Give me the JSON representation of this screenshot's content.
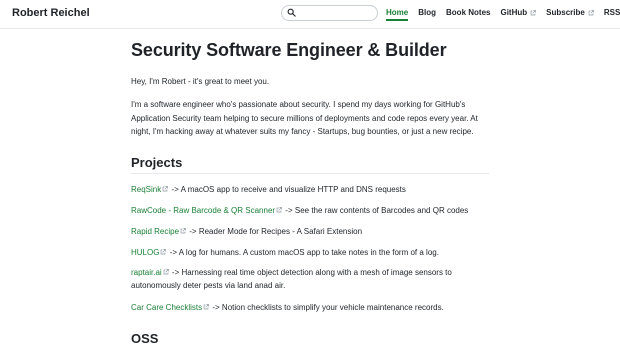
{
  "header": {
    "site_title": "Robert Reichel",
    "search": {
      "placeholder": "",
      "value": ""
    },
    "nav": [
      {
        "label": "Home",
        "external": false,
        "active": true
      },
      {
        "label": "Blog",
        "external": false,
        "active": false
      },
      {
        "label": "Book Notes",
        "external": false,
        "active": false
      },
      {
        "label": "GitHub",
        "external": true,
        "active": false
      },
      {
        "label": "Subscribe",
        "external": true,
        "active": false
      },
      {
        "label": "RSS",
        "external": true,
        "active": false
      }
    ]
  },
  "main": {
    "title": "Security Software Engineer & Builder",
    "greeting": "Hey, I'm Robert - it's great to meet you.",
    "bio": "I'm a software engineer who's passionate about security. I spend my days working for GitHub's Application Security team helping to secure millions of deployments and code repos every year. At night, I'm hacking away at whatever suits my fancy - Startups, bug bounties, or just a new recipe.",
    "projects_heading": "Projects",
    "projects": [
      {
        "name": "ReqSink",
        "desc": "-> A macOS app to receive and visualize HTTP and DNS requests"
      },
      {
        "name": "RawCode - Raw Barcode & QR Scanner",
        "desc": "-> See the raw contents of Barcodes and QR codes"
      },
      {
        "name": "Rapid Recipe",
        "desc": "-> Reader Mode for Recipes - A Safari Extension"
      },
      {
        "name": "HULOG",
        "desc": "-> A log for humans. A custom macOS app to take notes in the form of a log."
      },
      {
        "name": "raptair.ai",
        "desc": "-> Harnessing real time object detection along with a mesh of image sensors to autonomously deter pests via land anad air."
      },
      {
        "name": "Car Care Checklists",
        "desc": "-> Notion checklists to simplify your vehicle maintenance records."
      }
    ],
    "oss_heading": "OSS"
  },
  "colors": {
    "accent": "#1a7f37",
    "text": "#1f2328",
    "border": "#e6e8eb"
  }
}
